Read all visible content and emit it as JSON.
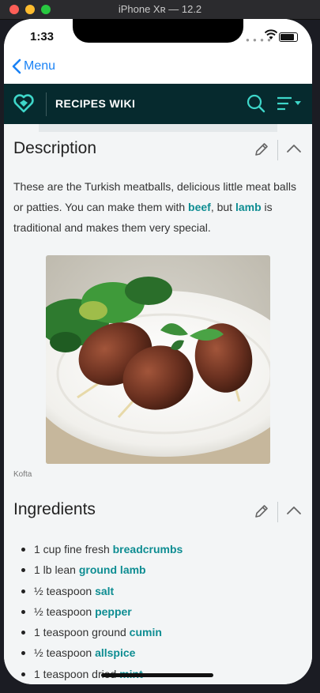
{
  "simulator": {
    "title": "iPhone Xʀ — 12.2"
  },
  "status_bar": {
    "time": "1:33"
  },
  "nav": {
    "back_label": "Menu"
  },
  "wiki_header": {
    "title": "RECIPES WIKI"
  },
  "description": {
    "heading": "Description",
    "text_1": "These are the Turkish meatballs, delicious little meat balls or patties. You can make them with ",
    "link_1": "beef",
    "text_2": ", but ",
    "link_2": "lamb",
    "text_3": " is traditional and makes them very special.",
    "image_caption": "Kofta"
  },
  "ingredients": {
    "heading": "Ingredients",
    "items": [
      {
        "text": "1 cup fine fresh ",
        "link": "breadcrumbs"
      },
      {
        "text": "1 lb lean ",
        "link": "ground lamb"
      },
      {
        "text": "½ teaspoon ",
        "link": "salt"
      },
      {
        "text": "½ teaspoon ",
        "link": "pepper"
      },
      {
        "text": "1 teaspoon ground ",
        "link": "cumin"
      },
      {
        "text": "½ teaspoon ",
        "link": "allspice"
      },
      {
        "text": "1 teaspoon dried ",
        "link": "mint"
      }
    ]
  },
  "colors": {
    "header_bg": "#062a2e",
    "accent": "#0e8d92",
    "ios_blue": "#1a82f5",
    "page_bg": "#f3f5f6"
  },
  "icons": [
    "heart-logo-icon",
    "search-icon",
    "menu-icon",
    "pencil-icon",
    "chevron-up-icon",
    "chevron-left-icon",
    "wifi-icon",
    "battery-icon"
  ]
}
